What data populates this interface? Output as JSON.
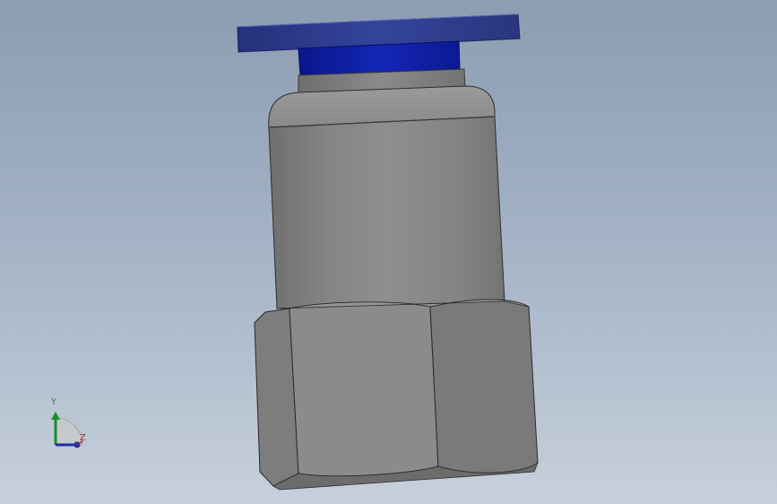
{
  "view": {
    "name": "cad-3d-viewport",
    "colors": {
      "background_top": "#8c9db2",
      "background_bottom": "#c7d0dc",
      "release_collar": "#2b3a8a",
      "collet": "#0f1f9e",
      "metal_body": "#8a8a8a"
    }
  },
  "model": {
    "parts": [
      "release-collar",
      "collet-ring",
      "body-cylinder",
      "hex-nut"
    ]
  },
  "triad": {
    "y_label": "Y",
    "z_label": "Z"
  }
}
